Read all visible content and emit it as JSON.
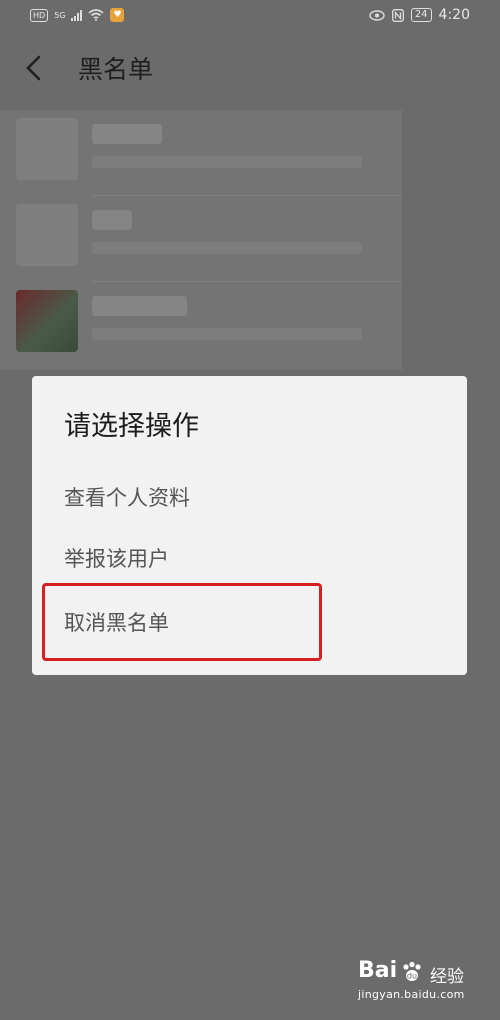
{
  "status_bar": {
    "hd": "HD",
    "network": "5G",
    "battery": "24",
    "time": "4:20"
  },
  "header": {
    "title": "黑名单",
    "back_icon": "chevron-left-icon"
  },
  "dialog": {
    "title": "请选择操作",
    "options": [
      {
        "label": "查看个人资料"
      },
      {
        "label": "举报该用户"
      },
      {
        "label": "取消黑名单"
      }
    ],
    "highlight_color": "#d42020"
  },
  "watermark": {
    "logo": "Bai",
    "product": "经验",
    "url": "jingyan.baidu.com"
  }
}
